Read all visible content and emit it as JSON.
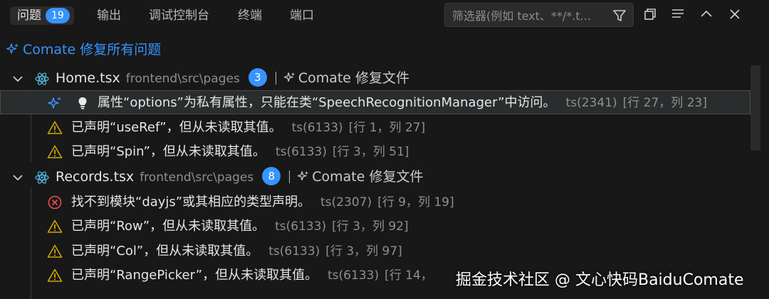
{
  "tabs": [
    {
      "label": "问题",
      "count": "19"
    },
    {
      "label": "输出"
    },
    {
      "label": "调试控制台"
    },
    {
      "label": "终端"
    },
    {
      "label": "端口"
    }
  ],
  "filter": {
    "placeholder": "筛选器(例如 text、**/*.t..."
  },
  "fix_all_label": "Comate 修复所有问题",
  "groups": [
    {
      "file": "Home.tsx",
      "path": "frontend\\src\\pages",
      "count": "3",
      "fix_label": "Comate 修复文件",
      "problems": [
        {
          "message": "属性“options”为私有属性，只能在类“SpeechRecognitionManager”中访问。",
          "code": "ts(2341)",
          "location": "[行 27，列 23]"
        },
        {
          "message": "已声明“useRef”，但从未读取其值。",
          "code": "ts(6133)",
          "location": "[行 1，列 27]"
        },
        {
          "message": "已声明“Spin”，但从未读取其值。",
          "code": "ts(6133)",
          "location": "[行 3，列 51]"
        }
      ]
    },
    {
      "file": "Records.tsx",
      "path": "frontend\\src\\pages",
      "count": "8",
      "fix_label": "Comate 修复文件",
      "problems": [
        {
          "message": "找不到模块“dayjs”或其相应的类型声明。",
          "code": "ts(2307)",
          "location": "[行 9，列 19]"
        },
        {
          "message": "已声明“Row”，但从未读取其值。",
          "code": "ts(6133)",
          "location": "[行 3，列 92]"
        },
        {
          "message": "已声明“Col”，但从未读取其值。",
          "code": "ts(6133)",
          "location": "[行 3，列 97]"
        },
        {
          "message": "已声明“RangePicker”，但从未读取其值。",
          "code": "ts(6133)",
          "location": "[行 14，"
        }
      ]
    }
  ],
  "watermark": "掘金技术社区 @ 文心快码BaiduComate",
  "colors": {
    "accent": "#3794ff",
    "warning": "#cca700",
    "error": "#f14c4c",
    "background": "#181818"
  }
}
